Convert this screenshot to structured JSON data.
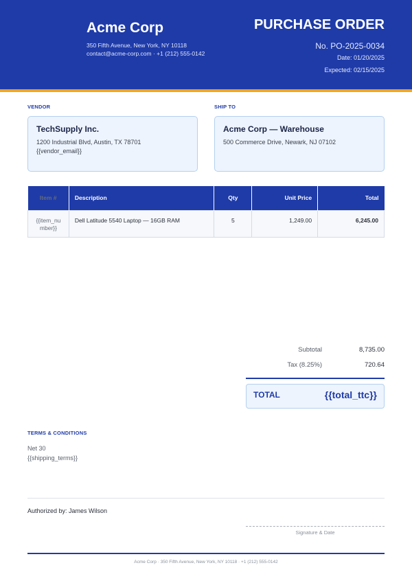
{
  "company": {
    "name": "Acme Corp",
    "address": "350 Fifth Avenue, New York, NY 10118",
    "contact": "contact@acme-corp.com · +1 (212) 555-0142"
  },
  "order": {
    "title": "PURCHASE ORDER",
    "number": "No. PO-2025-0034",
    "date": "Date: 01/20/2025",
    "expected": "Expected: 02/15/2025"
  },
  "vendor": {
    "label": "VENDOR",
    "name": "TechSupply Inc.",
    "address": "1200 Industrial Blvd, Austin, TX 78701",
    "email": "{{vendor_email}}"
  },
  "ship_to": {
    "label": "SHIP TO",
    "name": "Acme Corp — Warehouse",
    "address": "500 Commerce Drive, Newark, NJ 07102"
  },
  "items_table": {
    "headers": {
      "item": "Item #",
      "description": "Description",
      "qty": "Qty",
      "unit_price": "Unit Price",
      "total": "Total"
    },
    "rows": [
      {
        "item": "{{item_number}}",
        "description": "Dell Latitude 5540 Laptop — 16GB RAM",
        "qty": "5",
        "unit_price": "1,249.00",
        "total": "6,245.00"
      }
    ]
  },
  "summary": {
    "subtotal_label": "Subtotal",
    "subtotal_value": "8,735.00",
    "tax_label": "Tax (8.25%)",
    "tax_value": "720.64",
    "total_label": "TOTAL",
    "total_value": "{{total_ttc}}"
  },
  "terms": {
    "label": "TERMS & CONDITIONS",
    "payment": "Net 30",
    "shipping": "{{shipping_terms}}"
  },
  "authorization": {
    "text": "Authorized by: James Wilson",
    "signature_caption": "Signature & Date"
  },
  "footer": {
    "text": "Acme Corp · 350 Fifth Avenue, New York, NY 10118 · +1 (212) 555-0142"
  },
  "colors": {
    "primary": "#1f3ba8",
    "accent": "#f2a51a",
    "box_fill": "#eef4fd",
    "box_border": "#b3d0f0"
  }
}
